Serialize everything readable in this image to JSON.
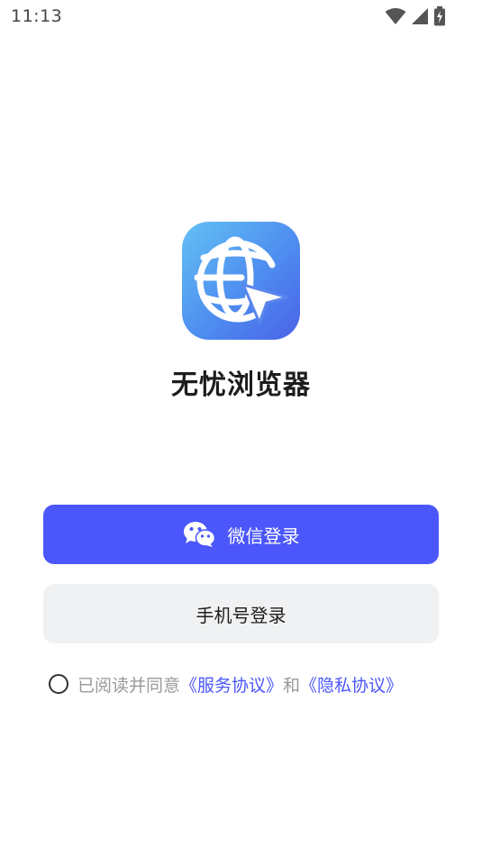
{
  "status_bar": {
    "time": "11:13",
    "icons": [
      "wifi-icon",
      "cellular-signal-icon",
      "battery-charging-icon"
    ]
  },
  "app": {
    "icon": "globe-cursor-logo",
    "name": "无忧浏览器"
  },
  "login": {
    "wechat_label": "微信登录",
    "wechat_icon": "wechat-icon",
    "phone_label": "手机号登录"
  },
  "agreement": {
    "checked": false,
    "prefix": "已阅读并同意",
    "service_link": "《服务协议》",
    "conjunction": "和",
    "privacy_link": "《隐私协议》"
  },
  "colors": {
    "primary": "#4b57fb",
    "secondary_button": "#f0f1f3",
    "muted_text": "#9a9a9a"
  }
}
